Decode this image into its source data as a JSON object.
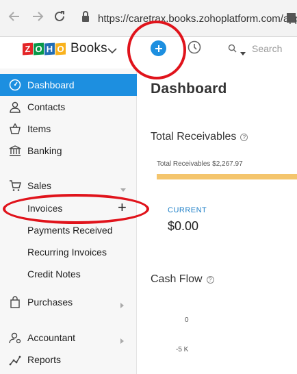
{
  "browser": {
    "url": "https://caretrax.books.zohoplatform.com/app#/"
  },
  "header": {
    "logo_letters": [
      "Z",
      "O",
      "H",
      "O"
    ],
    "logo_colors": [
      "#e42527",
      "#089949",
      "#226db4",
      "#f9b21d"
    ],
    "app_name": "Books",
    "search_placeholder": "Search"
  },
  "sidebar": {
    "dashboard": "Dashboard",
    "contacts": "Contacts",
    "items": "Items",
    "banking": "Banking",
    "sales": "Sales",
    "invoices": "Invoices",
    "add_symbol": "+",
    "payments_received": "Payments Received",
    "recurring_invoices": "Recurring Invoices",
    "credit_notes": "Credit Notes",
    "purchases": "Purchases",
    "accountant": "Accountant",
    "reports": "Reports"
  },
  "main": {
    "title": "Dashboard",
    "total_receivables_title": "Total Receivables",
    "total_receivables_label": "Total Receivables $2,267.97",
    "current_label": "CURRENT",
    "current_value": "$0.00",
    "cash_flow_title": "Cash Flow",
    "cash_flow_ticks": [
      "0",
      "-5 K"
    ]
  },
  "colors": {
    "accent": "#1d8fe0",
    "annotation": "#e0131b",
    "receivables_bar": "#f4c56d"
  }
}
